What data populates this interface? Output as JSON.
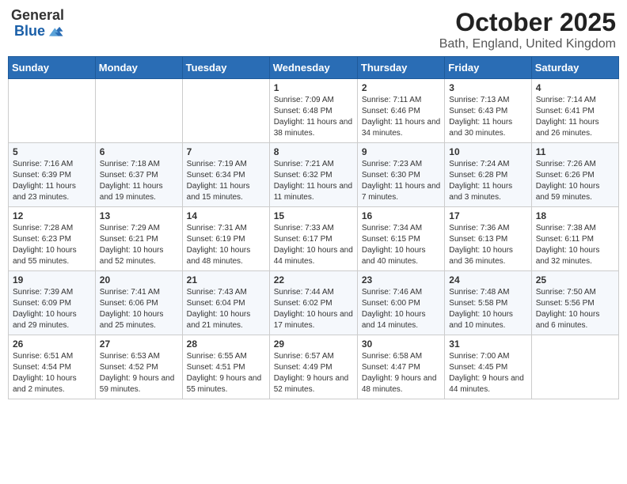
{
  "header": {
    "logo_general": "General",
    "logo_blue": "Blue",
    "month": "October 2025",
    "location": "Bath, England, United Kingdom"
  },
  "weekdays": [
    "Sunday",
    "Monday",
    "Tuesday",
    "Wednesday",
    "Thursday",
    "Friday",
    "Saturday"
  ],
  "weeks": [
    [
      {
        "day": "",
        "info": ""
      },
      {
        "day": "",
        "info": ""
      },
      {
        "day": "",
        "info": ""
      },
      {
        "day": "1",
        "info": "Sunrise: 7:09 AM\nSunset: 6:48 PM\nDaylight: 11 hours and 38 minutes."
      },
      {
        "day": "2",
        "info": "Sunrise: 7:11 AM\nSunset: 6:46 PM\nDaylight: 11 hours and 34 minutes."
      },
      {
        "day": "3",
        "info": "Sunrise: 7:13 AM\nSunset: 6:43 PM\nDaylight: 11 hours and 30 minutes."
      },
      {
        "day": "4",
        "info": "Sunrise: 7:14 AM\nSunset: 6:41 PM\nDaylight: 11 hours and 26 minutes."
      }
    ],
    [
      {
        "day": "5",
        "info": "Sunrise: 7:16 AM\nSunset: 6:39 PM\nDaylight: 11 hours and 23 minutes."
      },
      {
        "day": "6",
        "info": "Sunrise: 7:18 AM\nSunset: 6:37 PM\nDaylight: 11 hours and 19 minutes."
      },
      {
        "day": "7",
        "info": "Sunrise: 7:19 AM\nSunset: 6:34 PM\nDaylight: 11 hours and 15 minutes."
      },
      {
        "day": "8",
        "info": "Sunrise: 7:21 AM\nSunset: 6:32 PM\nDaylight: 11 hours and 11 minutes."
      },
      {
        "day": "9",
        "info": "Sunrise: 7:23 AM\nSunset: 6:30 PM\nDaylight: 11 hours and 7 minutes."
      },
      {
        "day": "10",
        "info": "Sunrise: 7:24 AM\nSunset: 6:28 PM\nDaylight: 11 hours and 3 minutes."
      },
      {
        "day": "11",
        "info": "Sunrise: 7:26 AM\nSunset: 6:26 PM\nDaylight: 10 hours and 59 minutes."
      }
    ],
    [
      {
        "day": "12",
        "info": "Sunrise: 7:28 AM\nSunset: 6:23 PM\nDaylight: 10 hours and 55 minutes."
      },
      {
        "day": "13",
        "info": "Sunrise: 7:29 AM\nSunset: 6:21 PM\nDaylight: 10 hours and 52 minutes."
      },
      {
        "day": "14",
        "info": "Sunrise: 7:31 AM\nSunset: 6:19 PM\nDaylight: 10 hours and 48 minutes."
      },
      {
        "day": "15",
        "info": "Sunrise: 7:33 AM\nSunset: 6:17 PM\nDaylight: 10 hours and 44 minutes."
      },
      {
        "day": "16",
        "info": "Sunrise: 7:34 AM\nSunset: 6:15 PM\nDaylight: 10 hours and 40 minutes."
      },
      {
        "day": "17",
        "info": "Sunrise: 7:36 AM\nSunset: 6:13 PM\nDaylight: 10 hours and 36 minutes."
      },
      {
        "day": "18",
        "info": "Sunrise: 7:38 AM\nSunset: 6:11 PM\nDaylight: 10 hours and 32 minutes."
      }
    ],
    [
      {
        "day": "19",
        "info": "Sunrise: 7:39 AM\nSunset: 6:09 PM\nDaylight: 10 hours and 29 minutes."
      },
      {
        "day": "20",
        "info": "Sunrise: 7:41 AM\nSunset: 6:06 PM\nDaylight: 10 hours and 25 minutes."
      },
      {
        "day": "21",
        "info": "Sunrise: 7:43 AM\nSunset: 6:04 PM\nDaylight: 10 hours and 21 minutes."
      },
      {
        "day": "22",
        "info": "Sunrise: 7:44 AM\nSunset: 6:02 PM\nDaylight: 10 hours and 17 minutes."
      },
      {
        "day": "23",
        "info": "Sunrise: 7:46 AM\nSunset: 6:00 PM\nDaylight: 10 hours and 14 minutes."
      },
      {
        "day": "24",
        "info": "Sunrise: 7:48 AM\nSunset: 5:58 PM\nDaylight: 10 hours and 10 minutes."
      },
      {
        "day": "25",
        "info": "Sunrise: 7:50 AM\nSunset: 5:56 PM\nDaylight: 10 hours and 6 minutes."
      }
    ],
    [
      {
        "day": "26",
        "info": "Sunrise: 6:51 AM\nSunset: 4:54 PM\nDaylight: 10 hours and 2 minutes."
      },
      {
        "day": "27",
        "info": "Sunrise: 6:53 AM\nSunset: 4:52 PM\nDaylight: 9 hours and 59 minutes."
      },
      {
        "day": "28",
        "info": "Sunrise: 6:55 AM\nSunset: 4:51 PM\nDaylight: 9 hours and 55 minutes."
      },
      {
        "day": "29",
        "info": "Sunrise: 6:57 AM\nSunset: 4:49 PM\nDaylight: 9 hours and 52 minutes."
      },
      {
        "day": "30",
        "info": "Sunrise: 6:58 AM\nSunset: 4:47 PM\nDaylight: 9 hours and 48 minutes."
      },
      {
        "day": "31",
        "info": "Sunrise: 7:00 AM\nSunset: 4:45 PM\nDaylight: 9 hours and 44 minutes."
      },
      {
        "day": "",
        "info": ""
      }
    ]
  ]
}
